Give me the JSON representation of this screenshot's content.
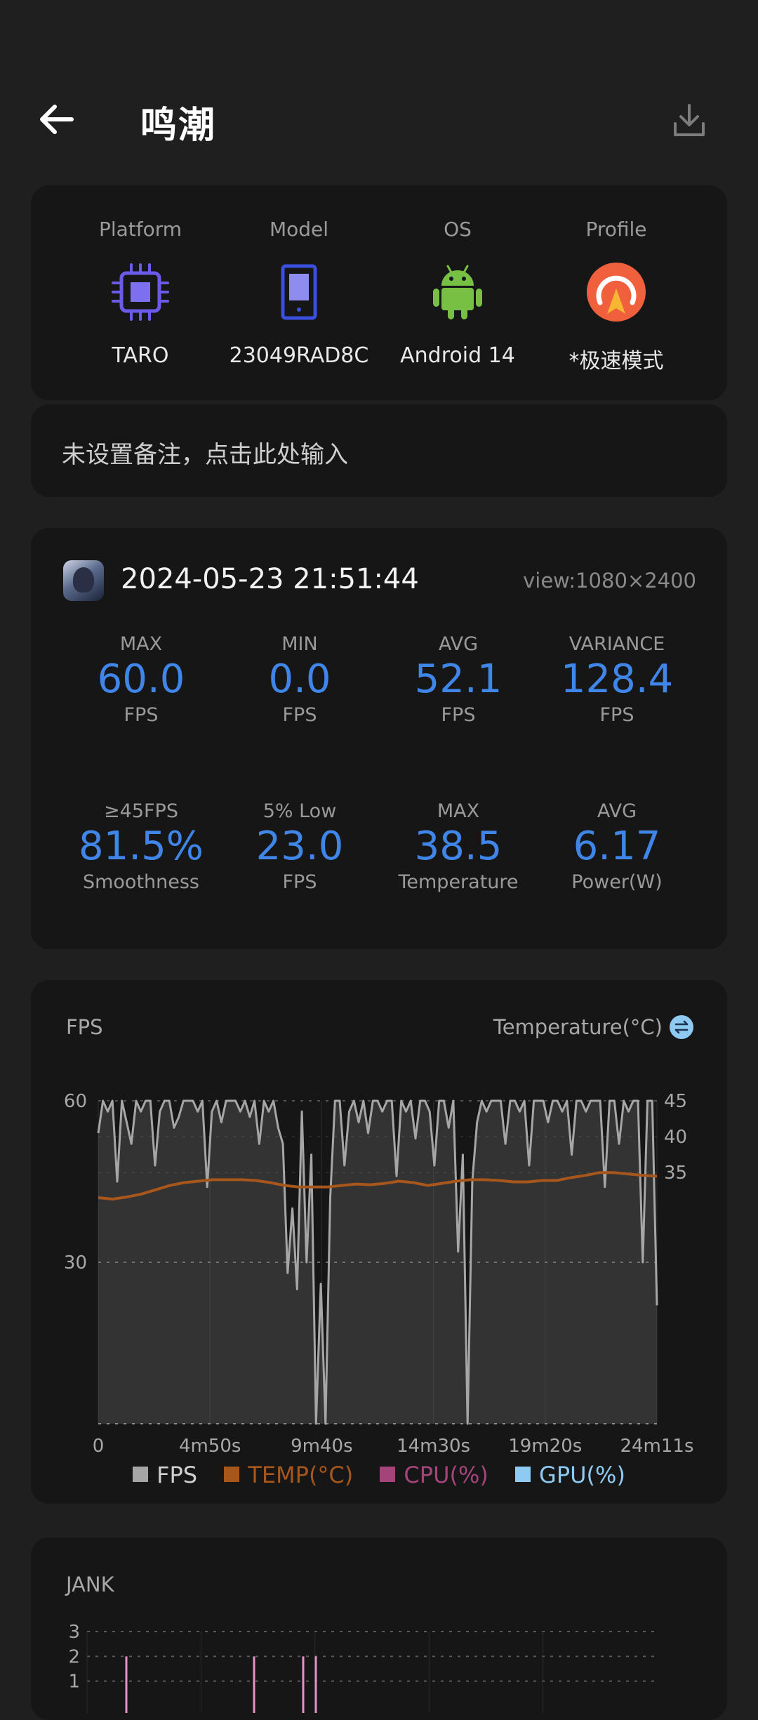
{
  "header": {
    "title": "鸣潮"
  },
  "device": [
    {
      "heading": "Platform",
      "value": "TARO",
      "icon": "cpu-icon"
    },
    {
      "heading": "Model",
      "value": "23049RAD8C",
      "icon": "phone-icon"
    },
    {
      "heading": "OS",
      "value": "Android 14",
      "icon": "android-icon"
    },
    {
      "heading": "Profile",
      "value": "*极速模式",
      "icon": "speed-mode-icon"
    }
  ],
  "note": {
    "placeholder": "未设置备注，点击此处输入"
  },
  "session": {
    "datetime": "2024-05-23 21:51:44",
    "view": "view:1080×2400"
  },
  "stats": [
    {
      "label": "MAX",
      "value": "60.0",
      "unit": "FPS"
    },
    {
      "label": "MIN",
      "value": "0.0",
      "unit": "FPS"
    },
    {
      "label": "AVG",
      "value": "52.1",
      "unit": "FPS"
    },
    {
      "label": "VARIANCE",
      "value": "128.4",
      "unit": "FPS"
    },
    {
      "label": "≥45FPS",
      "value": "81.5%",
      "unit": "Smoothness"
    },
    {
      "label": "5% Low",
      "value": "23.0",
      "unit": "FPS"
    },
    {
      "label": "MAX",
      "value": "38.5",
      "unit": "Temperature"
    },
    {
      "label": "AVG",
      "value": "6.17",
      "unit": "Power(W)"
    }
  ],
  "fps_chart": {
    "title": "FPS",
    "right_title": "Temperature(°C)",
    "legend": [
      {
        "label": "FPS",
        "color": "#a6a6a6"
      },
      {
        "label": "TEMP(°C)",
        "color": "#a7561c"
      },
      {
        "label": "CPU(%)",
        "color": "#a4447a"
      },
      {
        "label": "GPU(%)",
        "color": "#8fcaf3"
      }
    ]
  },
  "jank_chart": {
    "title": "JANK"
  },
  "chart_data": [
    {
      "type": "line",
      "title": "FPS",
      "x_tick_labels": [
        "0",
        "4m50s",
        "9m40s",
        "14m30s",
        "19m20s",
        "24m11s"
      ],
      "y_left_ticks": [
        "60",
        "30"
      ],
      "y_right_ticks": [
        "45",
        "40",
        "35"
      ],
      "ylim_left": [
        0,
        60
      ],
      "ylim_right": [
        0,
        45
      ],
      "grid": true,
      "series": [
        {
          "name": "FPS",
          "color": "#a6a6a6",
          "values": [
            54,
            60,
            58,
            60,
            45,
            60,
            56,
            52,
            60,
            58,
            60,
            60,
            48,
            58,
            60,
            60,
            55,
            57,
            60,
            60,
            60,
            58,
            60,
            44,
            58,
            60,
            56,
            60,
            60,
            60,
            58,
            60,
            57,
            60,
            52,
            60,
            58,
            60,
            55,
            52,
            28,
            40,
            25,
            58,
            30,
            50,
            0,
            26,
            0,
            42,
            60,
            60,
            48,
            58,
            60,
            56,
            60,
            54,
            60,
            60,
            58,
            60,
            60,
            46,
            60,
            58,
            60,
            53,
            60,
            60,
            58,
            48,
            60,
            60,
            55,
            60,
            32,
            50,
            0,
            45,
            56,
            60,
            58,
            60,
            60,
            60,
            52,
            60,
            60,
            58,
            60,
            48,
            60,
            60,
            60,
            56,
            60,
            60,
            58,
            60,
            50,
            60,
            60,
            58,
            60,
            60,
            60,
            44,
            60,
            60,
            52,
            60,
            58,
            60,
            60,
            30,
            60,
            60,
            22
          ]
        },
        {
          "name": "TEMP(°C)",
          "color": "#a7561c",
          "values": [
            31.5,
            31.3,
            31.6,
            32,
            32.6,
            33.2,
            33.6,
            33.8,
            34,
            34,
            34,
            33.9,
            33.6,
            33.2,
            33,
            33,
            33,
            33.2,
            33.4,
            33.3,
            33.5,
            33.8,
            33.6,
            33.2,
            33.5,
            33.8,
            34,
            34,
            33.9,
            33.7,
            33.7,
            33.9,
            33.9,
            34.3,
            34.6,
            35,
            35,
            34.8,
            34.6,
            34.5
          ]
        }
      ]
    },
    {
      "type": "bar",
      "title": "JANK",
      "y_tick_labels": [
        "3",
        "2",
        "1"
      ],
      "ylim": [
        0,
        3
      ]
    }
  ]
}
